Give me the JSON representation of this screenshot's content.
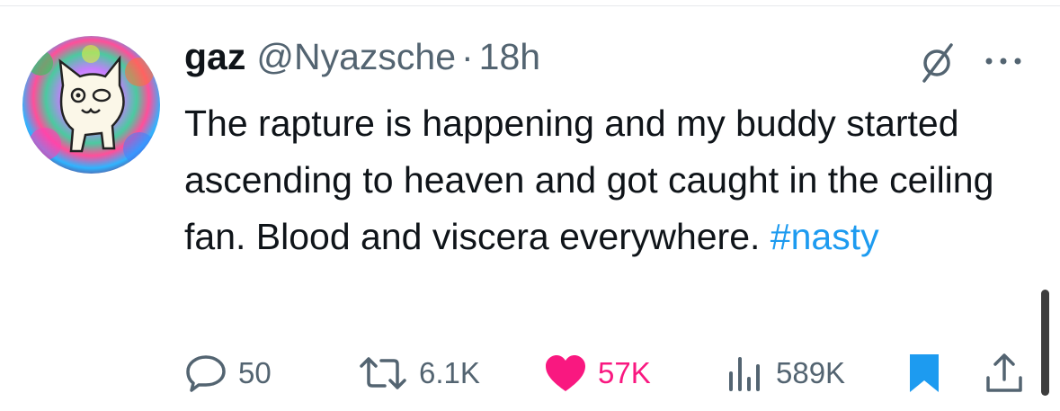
{
  "tweet": {
    "display_name": "gaz",
    "handle": "@Nyazsche",
    "separator": "·",
    "time": "18h",
    "text_main": "The rapture is happening and my buddy started ascending to heaven and got caught in the ceiling fan. Blood and viscera everywhere. ",
    "hashtag": "#nasty"
  },
  "actions": {
    "replies": "50",
    "reposts": "6.1K",
    "likes": "57K",
    "views": "589K"
  },
  "icons": {
    "avatar": "cartoon-cat-avatar",
    "grok": "grok-icon",
    "more": "more-options-icon",
    "reply": "reply-icon",
    "repost": "repost-icon",
    "like": "heart-icon",
    "views": "views-chart-icon",
    "bookmark": "bookmark-icon",
    "share": "share-icon"
  },
  "colors": {
    "text": "#0f1419",
    "secondary": "#536471",
    "link": "#1d9bf0",
    "like": "#f91880",
    "bookmark": "#1d9bf0"
  }
}
